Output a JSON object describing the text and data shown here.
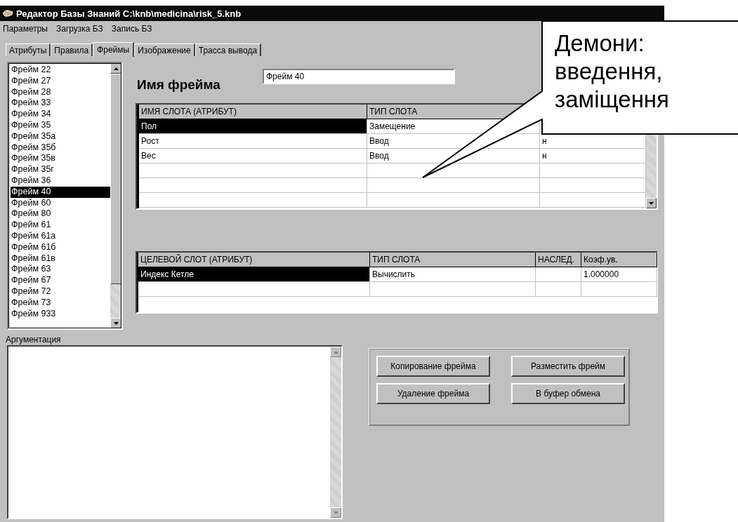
{
  "window": {
    "title": "Редактор Базы Знаний C:\\knb\\medicina\\risk_5.knb"
  },
  "menu": [
    "Параметры",
    "Загрузка БЗ",
    "Запись БЗ"
  ],
  "tabs": [
    {
      "label": "Атрибуты",
      "selected": false
    },
    {
      "label": "Правила",
      "selected": false
    },
    {
      "label": "Фреймы",
      "selected": true
    },
    {
      "label": "Изображение",
      "selected": false
    },
    {
      "label": "Трасса вывода",
      "selected": false
    }
  ],
  "frames_list": [
    {
      "label": "Фрейм 22",
      "selected": false
    },
    {
      "label": "Фрейм 27",
      "selected": false
    },
    {
      "label": "Фрейм 28",
      "selected": false
    },
    {
      "label": "Фрейм 33",
      "selected": false
    },
    {
      "label": "Фрейм 34",
      "selected": false
    },
    {
      "label": "Фрейм 35",
      "selected": false
    },
    {
      "label": "Фрейм 35а",
      "selected": false
    },
    {
      "label": "Фрейм 35б",
      "selected": false
    },
    {
      "label": "Фрейм 35в",
      "selected": false
    },
    {
      "label": "Фрейм 35г",
      "selected": false
    },
    {
      "label": "Фрейм 36",
      "selected": false
    },
    {
      "label": "Фрейм 40",
      "selected": true
    },
    {
      "label": "Фрейм 60",
      "selected": false
    },
    {
      "label": "Фрейм 80",
      "selected": false
    },
    {
      "label": "Фрейм 61",
      "selected": false
    },
    {
      "label": "Фрейм 61а",
      "selected": false
    },
    {
      "label": "Фрейм 61б",
      "selected": false
    },
    {
      "label": "Фрейм 61в",
      "selected": false
    },
    {
      "label": "Фрейм 63",
      "selected": false
    },
    {
      "label": "Фрейм 67",
      "selected": false
    },
    {
      "label": "Фрейм 72",
      "selected": false
    },
    {
      "label": "Фрейм 73",
      "selected": false
    },
    {
      "label": "Фрейм 933",
      "selected": false
    }
  ],
  "frame_name": {
    "label": "Имя фрейма",
    "value": "Фрейм 40"
  },
  "slots_table": {
    "columns": [
      "ИМЯ СЛОТА (АТРИБУТ)",
      "ТИП СЛОТА"
    ],
    "rows": [
      {
        "name": "Пол",
        "type": "Замещение",
        "selected": true
      },
      {
        "name": "Рост",
        "type": "Ввод",
        "column_3": "н",
        "selected": false
      },
      {
        "name": "Вес",
        "type": "Ввод",
        "column_3": "н",
        "selected": false
      }
    ]
  },
  "target_table": {
    "columns": [
      "ЦЕЛЕВОЙ СЛОТ (АТРИБУТ)",
      "ТИП СЛОТА",
      "НАСЛЕД.",
      "Коэф.ув."
    ],
    "rows": [
      {
        "slot": "Индекс Кетле",
        "type": "Вычислить",
        "coefficient": "1.000000",
        "selected": true
      }
    ]
  },
  "argumentation": {
    "label": "Аргументация"
  },
  "buttons": [
    "Копирование фрейма",
    "Разместить фрейм",
    "Удаление фрейма",
    "В буфер обмена"
  ],
  "callout": {
    "text": "Демони: введення, заміщення"
  }
}
